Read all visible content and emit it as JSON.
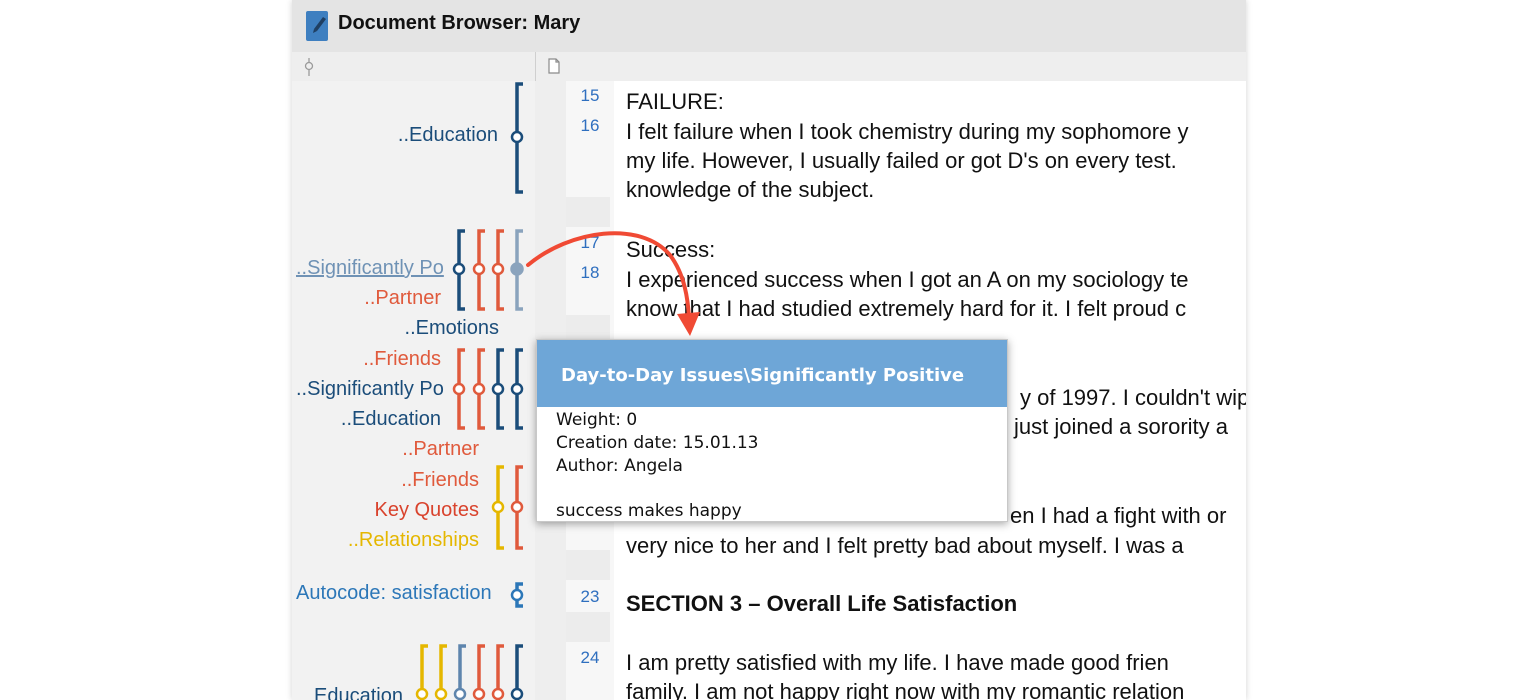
{
  "window": {
    "title": "Document Browser: Mary"
  },
  "icons": {
    "title": "pencil-document-icon",
    "margin_column": "pin-icon",
    "text_column": "document-icon"
  },
  "margin": {
    "codes": [
      {
        "label": "..Education",
        "color": "#1b4d7a"
      },
      {
        "label": "..Significantly Po",
        "color": "#6f92b5"
      },
      {
        "label": "..Partner",
        "color": "#e05a3c"
      },
      {
        "label": "..Emotions",
        "color": "#1b4d7a"
      },
      {
        "label": "..Friends",
        "color": "#e05a3c"
      },
      {
        "label": "..Significantly Po",
        "color": "#1b4d7a"
      },
      {
        "label": "..Education",
        "color": "#1b4d7a"
      },
      {
        "label": "..Partner",
        "color": "#e05a3c"
      },
      {
        "label": "..Friends",
        "color": "#e05a3c"
      },
      {
        "label": "Key Quotes",
        "color": "#d9432d"
      },
      {
        "label": "..Relationships",
        "color": "#e5b700"
      },
      {
        "label": "Autocode: satisfaction",
        "color": "#2c77b8"
      },
      {
        "label": "Education",
        "color": "#1b4d7a"
      }
    ]
  },
  "document": {
    "lines": [
      {
        "no": "15",
        "text": "FAILURE:"
      },
      {
        "no": "16",
        "text": "I felt failure when I took chemistry during my sophomore y"
      },
      {
        "no": "",
        "text": "my life. However, I usually failed or got D's on every test."
      },
      {
        "no": "",
        "text": "knowledge of the subject."
      },
      {
        "no": "17",
        "text": "Success:"
      },
      {
        "no": "18",
        "text": "I experienced success when I got an A on my sociology te"
      },
      {
        "no": "",
        "text": "know that I had studied extremely hard for it. I felt proud c"
      },
      {
        "no": "",
        "text": "y of 1997. I couldn't wip"
      },
      {
        "no": "",
        "text": "just joined a sorority a"
      },
      {
        "no": "",
        "text": "en I had a fight with or"
      },
      {
        "no": "",
        "text": "very nice to her and I felt pretty bad about myself.  I was a"
      },
      {
        "no": "23",
        "text": "SECTION 3 – Overall Life Satisfaction"
      },
      {
        "no": "24",
        "text": "  I am pretty satisfied with my life. I have made good frien"
      },
      {
        "no": "",
        "text": "family. I am not happy right now with my romantic relation"
      }
    ]
  },
  "tooltip": {
    "title": "Day-to-Day Issues\\Significantly Positive",
    "weight": "Weight: 0",
    "creation_date": "Creation date: 15.01.13",
    "author": "Author: Angela",
    "memo": "success makes happy",
    "header_color": "#6ea6d7"
  },
  "colors": {
    "arrow": "#f04a34"
  }
}
